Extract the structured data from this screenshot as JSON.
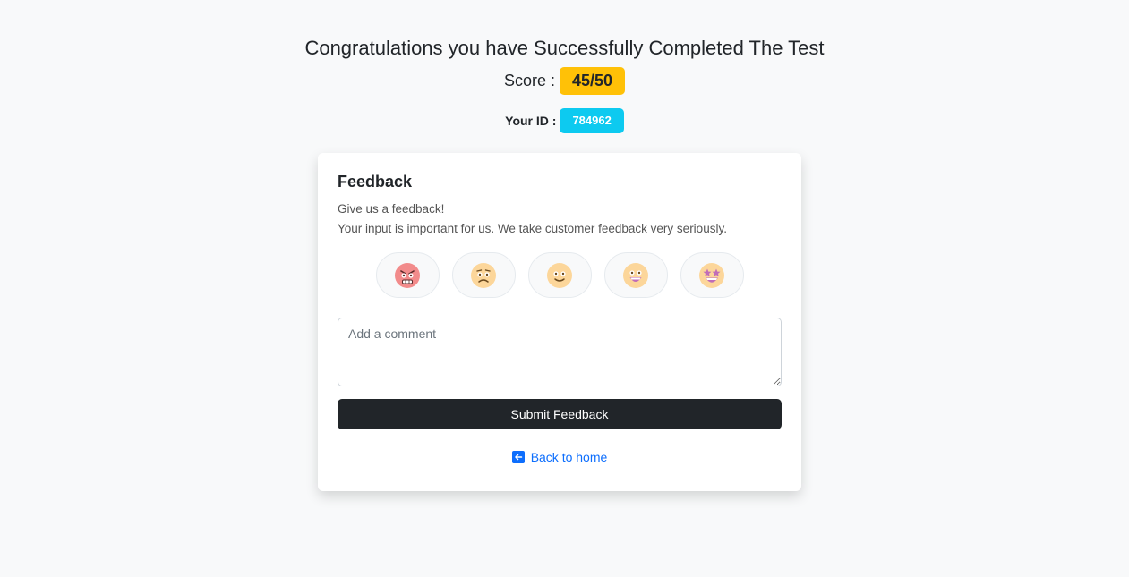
{
  "header": {
    "title": "Congratulations you have Successfully Completed The Test",
    "score_label": "Score :",
    "score_value": "45/50",
    "id_label": "Your ID :",
    "id_value": "784962"
  },
  "feedback": {
    "title": "Feedback",
    "line1": "Give us a feedback!",
    "line2": "Your input is important for us. We take customer feedback very seriously.",
    "emojis": [
      "angry-face-icon",
      "confused-face-icon",
      "smiling-face-icon",
      "grinning-face-icon",
      "star-struck-face-icon"
    ],
    "comment_placeholder": "Add a comment",
    "submit_label": "Submit Feedback",
    "back_label": "Back to home"
  },
  "colors": {
    "score_badge": "#ffc107",
    "id_badge": "#0dcaf0",
    "submit_button": "#212529",
    "link": "#0d6efd",
    "background": "#f8f9fa"
  }
}
